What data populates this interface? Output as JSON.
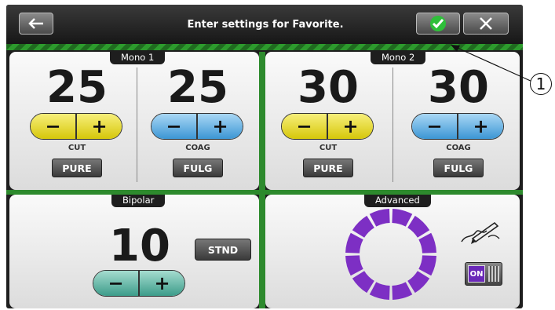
{
  "header": {
    "title": "Enter settings for Favorite.",
    "back_icon": "arrow-left-icon",
    "confirm_icon": "check-icon",
    "close_icon": "close-icon"
  },
  "mono1": {
    "tab": "Mono 1",
    "cut": {
      "value": "25",
      "label": "CUT",
      "mode": "PURE"
    },
    "coag": {
      "value": "25",
      "label": "COAG",
      "mode": "FULG"
    }
  },
  "mono2": {
    "tab": "Mono 2",
    "cut": {
      "value": "30",
      "label": "CUT",
      "mode": "PURE"
    },
    "coag": {
      "value": "30",
      "label": "COAG",
      "mode": "FULG"
    }
  },
  "bipolar": {
    "tab": "Bipolar",
    "value": "10",
    "mode": "STND"
  },
  "advanced": {
    "tab": "Advanced",
    "toggle": "ON",
    "ring_segments": 12,
    "pen_icon": "signature-pen-icon"
  },
  "buttons": {
    "minus": "−",
    "plus": "+"
  },
  "callout": {
    "number": "1"
  },
  "colors": {
    "cut": "#e2d21a",
    "coag": "#3c96d4",
    "bipolar": "#3c9c8a",
    "advanced": "#7d2fc4",
    "confirm": "#2fbf3a",
    "divider": "#2d8a2d"
  }
}
